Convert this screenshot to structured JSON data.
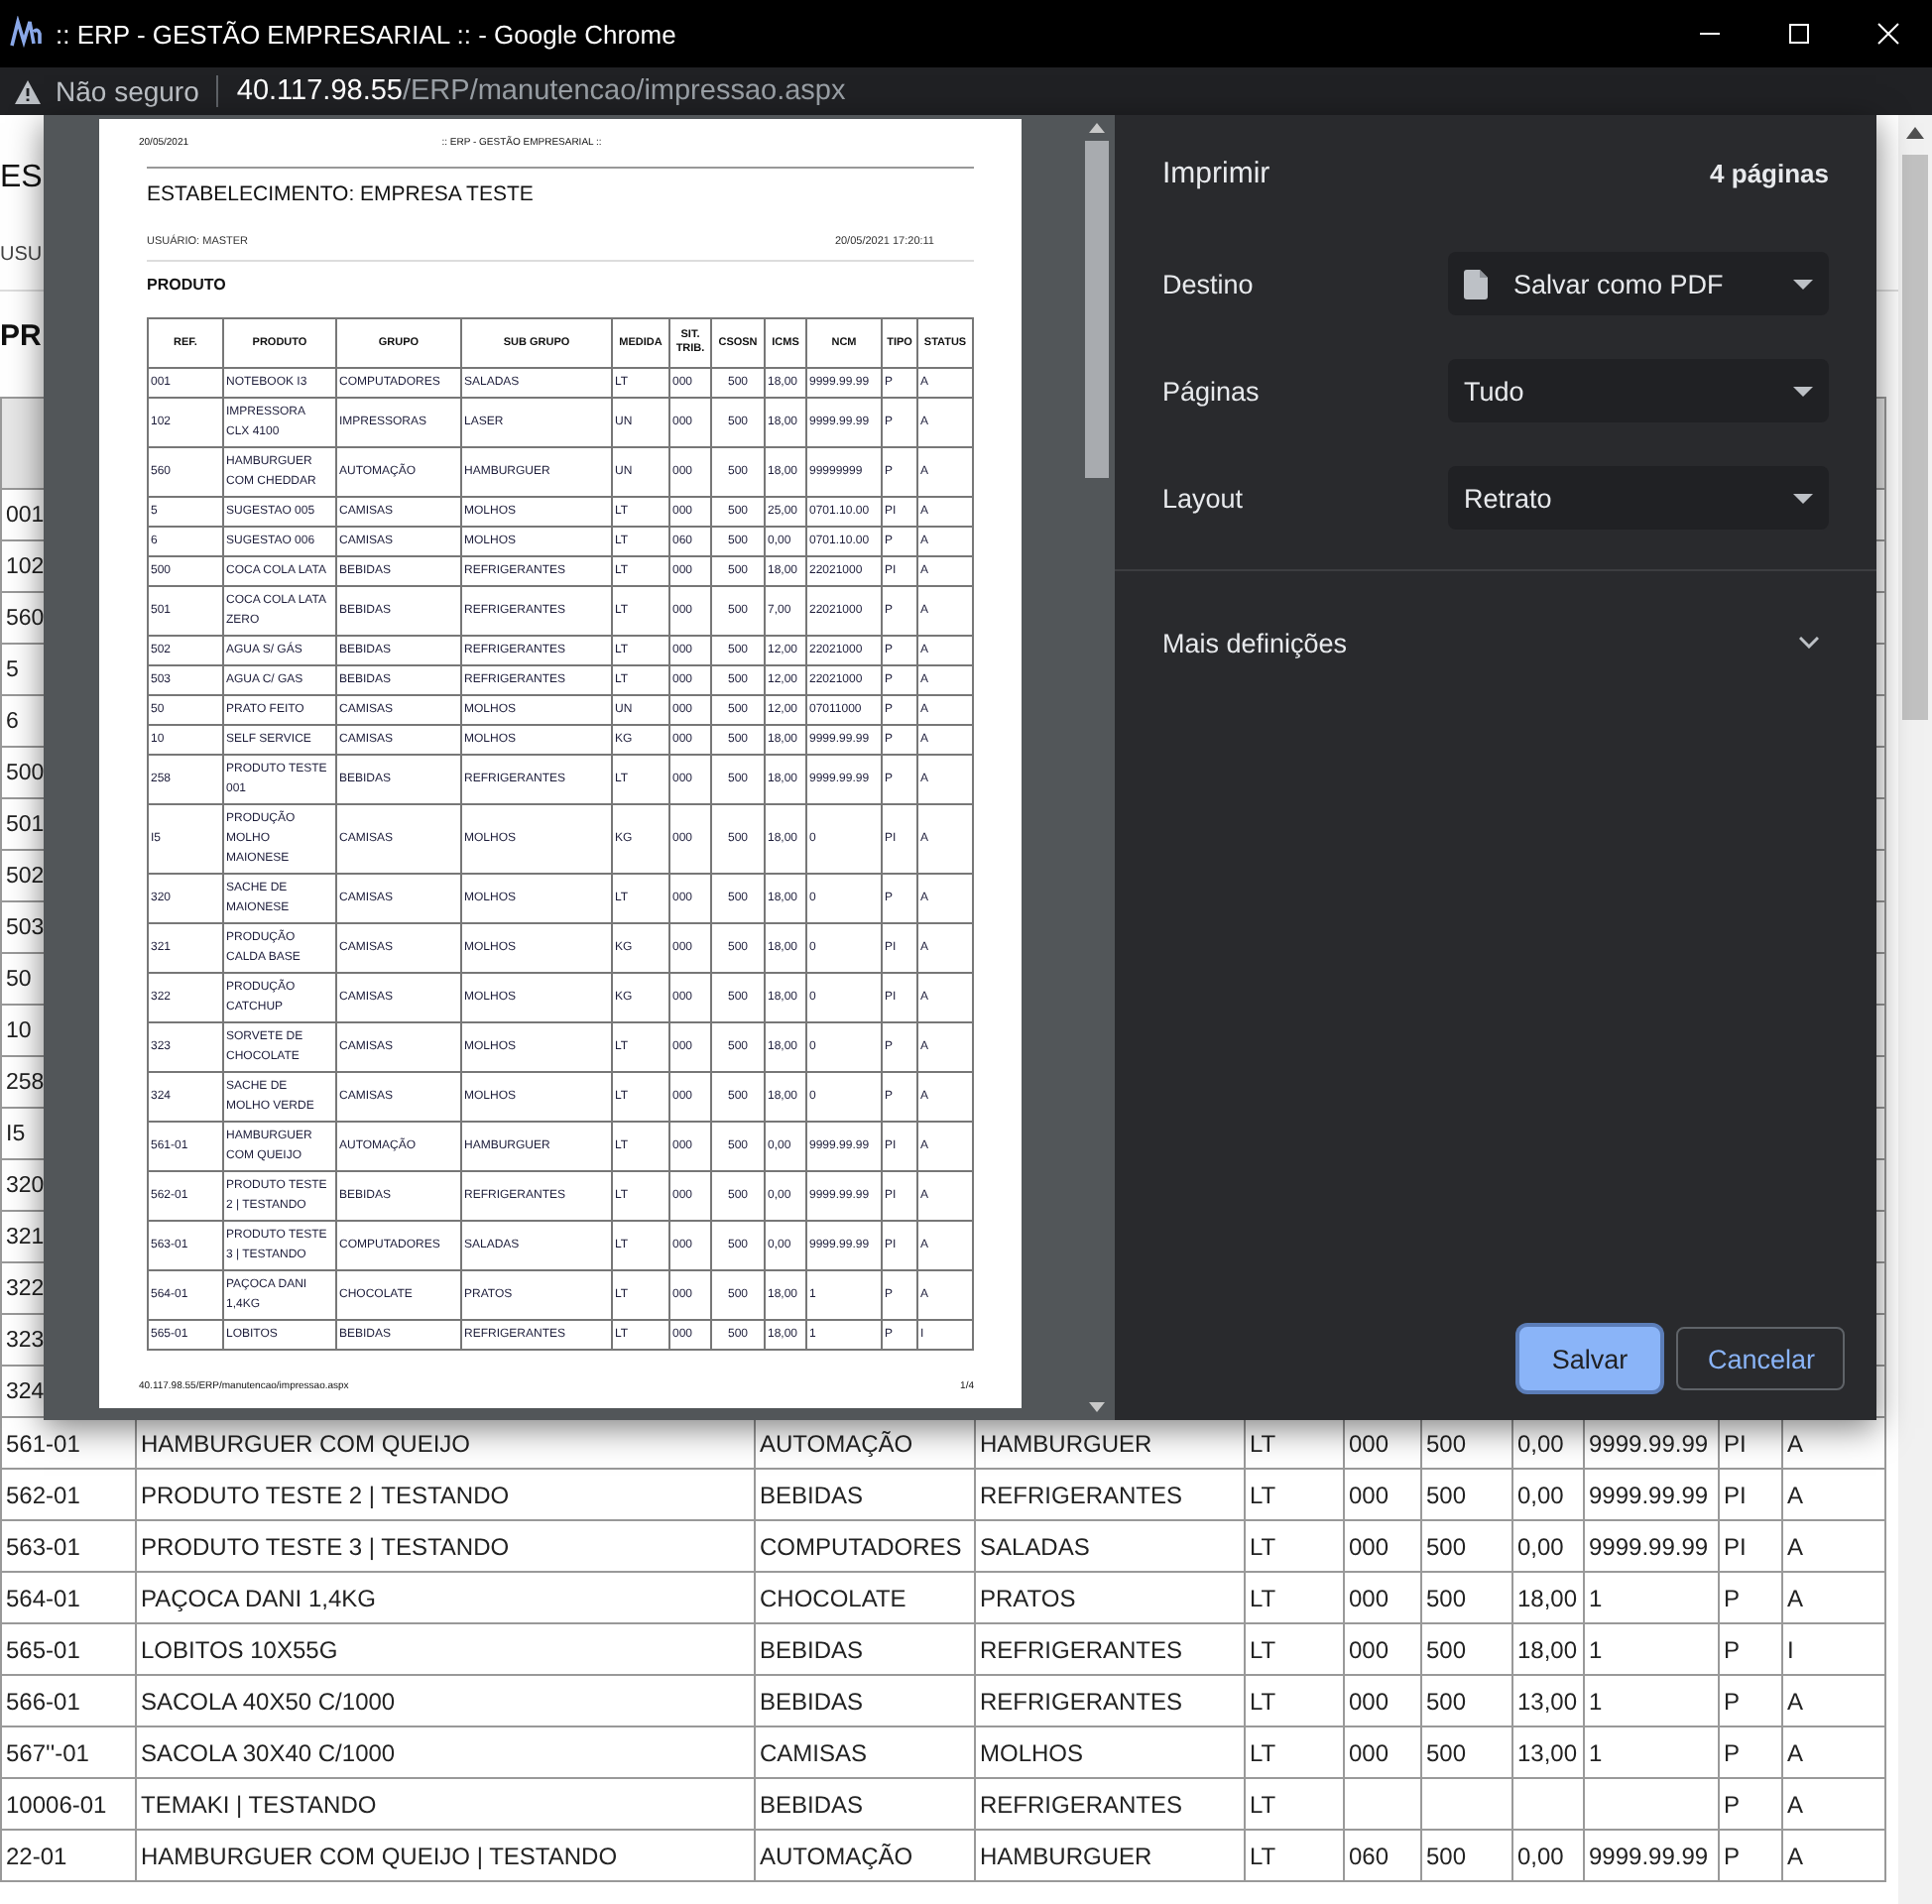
{
  "browser": {
    "title": ":: ERP - GESTÃO EMPRESARIAL :: - Google Chrome",
    "security": "Não seguro",
    "url_host": "40.117.98.55",
    "url_path": "/ERP/manutencao/impressao.aspx"
  },
  "page_behind": {
    "heading": "ES",
    "user": "USU",
    "section": "PR",
    "row_refs": [
      "001",
      "102",
      "560",
      "5",
      "6",
      "500",
      "501",
      "502",
      "503",
      "50",
      "10",
      "258",
      "I5",
      "320",
      "321",
      "322",
      "323",
      "324"
    ],
    "rows": [
      [
        "561-01",
        "HAMBURGUER COM QUEIJO",
        "AUTOMAÇÃO",
        "HAMBURGUER",
        "LT",
        "000",
        "500",
        "0,00",
        "9999.99.99",
        "PI",
        "A"
      ],
      [
        "562-01",
        "PRODUTO TESTE 2 | TESTANDO",
        "BEBIDAS",
        "REFRIGERANTES",
        "LT",
        "000",
        "500",
        "0,00",
        "9999.99.99",
        "PI",
        "A"
      ],
      [
        "563-01",
        "PRODUTO TESTE 3 | TESTANDO",
        "COMPUTADORES",
        "SALADAS",
        "LT",
        "000",
        "500",
        "0,00",
        "9999.99.99",
        "PI",
        "A"
      ],
      [
        "564-01",
        "PAÇOCA DANI 1,4KG",
        "CHOCOLATE",
        "PRATOS",
        "LT",
        "000",
        "500",
        "18,00",
        "1",
        "P",
        "A"
      ],
      [
        "565-01",
        "LOBITOS 10X55G",
        "BEBIDAS",
        "REFRIGERANTES",
        "LT",
        "000",
        "500",
        "18,00",
        "1",
        "P",
        "I"
      ],
      [
        "566-01",
        "SACOLA 40X50 C/1000",
        "BEBIDAS",
        "REFRIGERANTES",
        "LT",
        "000",
        "500",
        "13,00",
        "1",
        "P",
        "A"
      ],
      [
        "567''-01",
        "SACOLA 30X40 C/1000",
        "CAMISAS",
        "MOLHOS",
        "LT",
        "000",
        "500",
        "13,00",
        "1",
        "P",
        "A"
      ],
      [
        "10006-01",
        "TEMAKI | TESTANDO",
        "BEBIDAS",
        "REFRIGERANTES",
        "LT",
        "",
        "",
        "",
        "",
        "P",
        "A"
      ],
      [
        "22-01",
        "HAMBURGUER COM QUEIJO | TESTANDO",
        "AUTOMAÇÃO",
        "HAMBURGUER",
        "LT",
        "060",
        "500",
        "0,00",
        "9999.99.99",
        "P",
        "A"
      ]
    ]
  },
  "print_dialog": {
    "title": "Imprimir",
    "page_count": "4 páginas",
    "settings": [
      {
        "label": "Destino",
        "value": "Salvar como PDF",
        "kind": "destination"
      },
      {
        "label": "Páginas",
        "value": "Tudo",
        "kind": "select"
      },
      {
        "label": "Layout",
        "value": "Retrato",
        "kind": "select"
      }
    ],
    "more_settings": {
      "label": "Mais definições",
      "expanded": false
    },
    "buttons": [
      {
        "label": "Salvar",
        "kind": "primary"
      },
      {
        "label": "Cancelar",
        "kind": "secondary"
      }
    ]
  },
  "preview": {
    "header_date": "20/05/2021",
    "header_title": ":: ERP - GESTÃO EMPRESARIAL ::",
    "establishment": "ESTABELECIMENTO: EMPRESA TESTE",
    "user": "USUÁRIO: MASTER",
    "timestamp": "20/05/2021 17:20:11",
    "section": "PRODUTO",
    "columns": [
      "REF.",
      "PRODUTO",
      "GRUPO",
      "SUB GRUPO",
      "MEDIDA",
      "SIT. TRIB.",
      "CSOSN",
      "ICMS",
      "NCM",
      "TIPO",
      "STATUS"
    ],
    "rows": [
      [
        "001",
        "NOTEBOOK I3",
        "COMPUTADORES",
        "SALADAS",
        "LT",
        "000",
        "500",
        "18,00",
        "9999.99.99",
        "P",
        "A"
      ],
      [
        "102",
        "IMPRESSORA CLX 4100",
        "IMPRESSORAS",
        "LASER",
        "UN",
        "000",
        "500",
        "18,00",
        "9999.99.99",
        "P",
        "A"
      ],
      [
        "560",
        "HAMBURGUER COM CHEDDAR",
        "AUTOMAÇÃO",
        "HAMBURGUER",
        "UN",
        "000",
        "500",
        "18,00",
        "99999999",
        "P",
        "A"
      ],
      [
        "5",
        "SUGESTAO 005",
        "CAMISAS",
        "MOLHOS",
        "LT",
        "000",
        "500",
        "25,00",
        "0701.10.00",
        "PI",
        "A"
      ],
      [
        "6",
        "SUGESTAO 006",
        "CAMISAS",
        "MOLHOS",
        "LT",
        "060",
        "500",
        "0,00",
        "0701.10.00",
        "P",
        "A"
      ],
      [
        "500",
        "COCA COLA LATA",
        "BEBIDAS",
        "REFRIGERANTES",
        "LT",
        "000",
        "500",
        "18,00",
        "22021000",
        "PI",
        "A"
      ],
      [
        "501",
        "COCA COLA LATA ZERO",
        "BEBIDAS",
        "REFRIGERANTES",
        "LT",
        "000",
        "500",
        "7,00",
        "22021000",
        "P",
        "A"
      ],
      [
        "502",
        "AGUA S/ GÁS",
        "BEBIDAS",
        "REFRIGERANTES",
        "LT",
        "000",
        "500",
        "12,00",
        "22021000",
        "P",
        "A"
      ],
      [
        "503",
        "AGUA C/ GAS",
        "BEBIDAS",
        "REFRIGERANTES",
        "LT",
        "000",
        "500",
        "12,00",
        "22021000",
        "P",
        "A"
      ],
      [
        "50",
        "PRATO FEITO",
        "CAMISAS",
        "MOLHOS",
        "UN",
        "000",
        "500",
        "12,00",
        "07011000",
        "P",
        "A"
      ],
      [
        "10",
        "SELF SERVICE",
        "CAMISAS",
        "MOLHOS",
        "KG",
        "000",
        "500",
        "18,00",
        "9999.99.99",
        "P",
        "A"
      ],
      [
        "258",
        "PRODUTO TESTE 001",
        "BEBIDAS",
        "REFRIGERANTES",
        "LT",
        "000",
        "500",
        "18,00",
        "9999.99.99",
        "P",
        "A"
      ],
      [
        "I5",
        "PRODUÇÃO MOLHO MAIONESE",
        "CAMISAS",
        "MOLHOS",
        "KG",
        "000",
        "500",
        "18,00",
        "0",
        "PI",
        "A"
      ],
      [
        "320",
        "SACHE DE MAIONESE",
        "CAMISAS",
        "MOLHOS",
        "LT",
        "000",
        "500",
        "18,00",
        "0",
        "P",
        "A"
      ],
      [
        "321",
        "PRODUÇÃO CALDA BASE",
        "CAMISAS",
        "MOLHOS",
        "KG",
        "000",
        "500",
        "18,00",
        "0",
        "PI",
        "A"
      ],
      [
        "322",
        "PRODUÇÃO CATCHUP",
        "CAMISAS",
        "MOLHOS",
        "KG",
        "000",
        "500",
        "18,00",
        "0",
        "PI",
        "A"
      ],
      [
        "323",
        "SORVETE DE CHOCOLATE",
        "CAMISAS",
        "MOLHOS",
        "LT",
        "000",
        "500",
        "18,00",
        "0",
        "P",
        "A"
      ],
      [
        "324",
        "SACHE DE MOLHO VERDE",
        "CAMISAS",
        "MOLHOS",
        "LT",
        "000",
        "500",
        "18,00",
        "0",
        "P",
        "A"
      ],
      [
        "561-01",
        "HAMBURGUER COM QUEIJO",
        "AUTOMAÇÃO",
        "HAMBURGUER",
        "LT",
        "000",
        "500",
        "0,00",
        "9999.99.99",
        "PI",
        "A"
      ],
      [
        "562-01",
        "PRODUTO TESTE 2 | TESTANDO",
        "BEBIDAS",
        "REFRIGERANTES",
        "LT",
        "000",
        "500",
        "0,00",
        "9999.99.99",
        "PI",
        "A"
      ],
      [
        "563-01",
        "PRODUTO TESTE 3 | TESTANDO",
        "COMPUTADORES",
        "SALADAS",
        "LT",
        "000",
        "500",
        "0,00",
        "9999.99.99",
        "PI",
        "A"
      ],
      [
        "564-01",
        "PAÇOCA DANI 1,4KG",
        "CHOCOLATE",
        "PRATOS",
        "LT",
        "000",
        "500",
        "18,00",
        "1",
        "P",
        "A"
      ],
      [
        "565-01",
        "LOBITOS",
        "BEBIDAS",
        "REFRIGERANTES",
        "LT",
        "000",
        "500",
        "18,00",
        "1",
        "P",
        "I"
      ]
    ],
    "footer_url": "40.117.98.55/ERP/manutencao/impressao.aspx",
    "footer_page": "1/4"
  }
}
